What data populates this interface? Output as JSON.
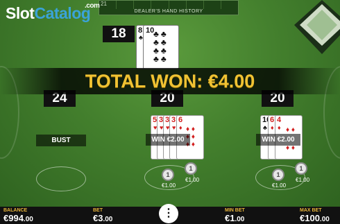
{
  "watermark": {
    "slot": "Slot",
    "catalog": "Catalog",
    "com": ".com"
  },
  "history": {
    "first_cell": "21",
    "label": "DEALER'S HAND HISTORY"
  },
  "dealer": {
    "score": "18",
    "cards": [
      {
        "rank": "8",
        "suit": "♣"
      },
      {
        "rank": "10",
        "suit": "♣"
      }
    ]
  },
  "banner": "TOTAL WON: €4.00",
  "hands": [
    {
      "score": "24",
      "result": "BUST",
      "cards": []
    },
    {
      "score": "20",
      "result": "WIN",
      "win_amount": "€2.00",
      "cards": [
        {
          "rank": "5",
          "suit": "♥"
        },
        {
          "rank": "3",
          "suit": "♥"
        },
        {
          "rank": "6",
          "suit": "♦"
        }
      ],
      "chips": [
        {
          "value": "1",
          "label": "€1.00"
        },
        {
          "value": "1",
          "label": "€1.00"
        }
      ]
    },
    {
      "score": "20",
      "result": "WIN",
      "win_amount": "€2.00",
      "cards": [
        {
          "rank": "10",
          "suit": "♣"
        },
        {
          "rank": "6",
          "suit": "♦"
        },
        {
          "rank": "4",
          "suit": "♦"
        }
      ],
      "chips": [
        {
          "value": "1",
          "label": "€1.00"
        },
        {
          "value": "1",
          "label": "€1.00"
        }
      ]
    }
  ],
  "bottom_bar": {
    "balance_label": "BALANCE",
    "balance_main": "€994",
    "balance_cents": ".00",
    "bet_label": "BET",
    "bet_main": "€3",
    "bet_cents": ".00",
    "min_bet_label": "MIN BET",
    "min_bet_main": "€1",
    "min_bet_cents": ".00",
    "max_bet_label": "MAX BET",
    "max_bet_main": "€100",
    "max_bet_cents": ".00",
    "menu_icon": "⋮"
  },
  "colors": {
    "felt": "#437f2d",
    "banner_text": "#f0c233",
    "label_gold": "#e8b53b"
  }
}
